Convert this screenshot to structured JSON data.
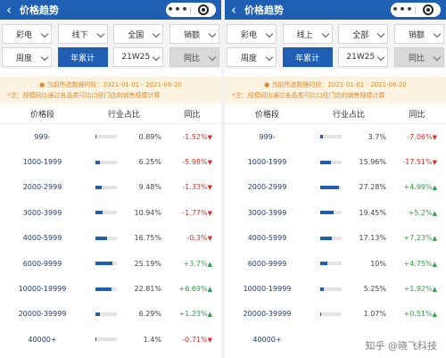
{
  "colors": {
    "header": "#1f5fb3",
    "negative": "#d93025",
    "positive": "#2f9e44",
    "notice_text": "#e08a2c",
    "notice_bg": "#fdf3e1"
  },
  "panels": [
    {
      "header": {
        "back": "‹",
        "title": "价格趋势",
        "dots": "•••"
      },
      "filters": {
        "row1": [
          "彩电",
          "线下",
          "全国",
          "销额"
        ],
        "row2": [
          "周度",
          "年累计",
          "21W25",
          "同比"
        ],
        "active_label": "年累计",
        "disabled_label": "同比"
      },
      "notice": {
        "line1": "● 当前所选数据时段：2021-01-01 - 2021-06-20",
        "line2": "*注：规模同比通过各品类可比口径门店的销售规模计算"
      },
      "table_header": {
        "col1": "价格段",
        "col2": "行业占比",
        "col3": "同比"
      },
      "rows": [
        {
          "range": "999-",
          "share": "0.89%",
          "share_value": 0.89,
          "yoy": "-1.52%",
          "dir": "down"
        },
        {
          "range": "1000-1999",
          "share": "6.25%",
          "share_value": 6.25,
          "yoy": "-5.98%",
          "dir": "down"
        },
        {
          "range": "2000-2999",
          "share": "9.48%",
          "share_value": 9.48,
          "yoy": "-1.33%",
          "dir": "down"
        },
        {
          "range": "3000-3999",
          "share": "10.94%",
          "share_value": 10.94,
          "yoy": "-1.77%",
          "dir": "down"
        },
        {
          "range": "4000-5999",
          "share": "16.75%",
          "share_value": 16.75,
          "yoy": "-0.3%",
          "dir": "down"
        },
        {
          "range": "6000-9999",
          "share": "25.19%",
          "share_value": 25.19,
          "yoy": "+3.7%",
          "dir": "up"
        },
        {
          "range": "10000-19999",
          "share": "22.81%",
          "share_value": 22.81,
          "yoy": "+6.69%",
          "dir": "up"
        },
        {
          "range": "20000-39999",
          "share": "6.29%",
          "share_value": 6.29,
          "yoy": "+1.23%",
          "dir": "up"
        },
        {
          "range": "40000+",
          "share": "1.4%",
          "share_value": 1.4,
          "yoy": "-0.71%",
          "dir": "down"
        }
      ]
    },
    {
      "header": {
        "back": "‹",
        "title": "价格趋势",
        "dots": "•••"
      },
      "filters": {
        "row1": [
          "彩电",
          "线上",
          "全部",
          "销额"
        ],
        "row2": [
          "周度",
          "年累计",
          "21W25",
          "同比"
        ],
        "active_label": "年累计",
        "disabled_label": "同比"
      },
      "notice": {
        "line1": "● 当前所选数据时段：2021-01-01 - 2021-06-20",
        "line2": "*注：规模同比通过各品类可比口径门店的销售规模计算"
      },
      "table_header": {
        "col1": "价格段",
        "col2": "行业占比",
        "col3": "同比"
      },
      "rows": [
        {
          "range": "999-",
          "share": "3.7%",
          "share_value": 3.7,
          "yoy": "-7.06%",
          "dir": "down"
        },
        {
          "range": "1000-1999",
          "share": "15.96%",
          "share_value": 15.96,
          "yoy": "-17.51%",
          "dir": "down"
        },
        {
          "range": "2000-2999",
          "share": "27.28%",
          "share_value": 27.28,
          "yoy": "+4.99%",
          "dir": "up"
        },
        {
          "range": "3000-3999",
          "share": "19.45%",
          "share_value": 19.45,
          "yoy": "+5.2%",
          "dir": "up"
        },
        {
          "range": "4000-5999",
          "share": "17.13%",
          "share_value": 17.13,
          "yoy": "+7.23%",
          "dir": "up"
        },
        {
          "range": "6000-9999",
          "share": "10%",
          "share_value": 10,
          "yoy": "+4.75%",
          "dir": "up"
        },
        {
          "range": "10000-19999",
          "share": "5.25%",
          "share_value": 5.25,
          "yoy": "+1.92%",
          "dir": "up"
        },
        {
          "range": "20000-39999",
          "share": "1.07%",
          "share_value": 1.07,
          "yoy": "+0.51%",
          "dir": "up"
        },
        {
          "range": "40000+",
          "share": "",
          "share_value": 0,
          "yoy": "",
          "dir": ""
        }
      ]
    }
  ],
  "watermark": "知乎 @晓飞科技"
}
